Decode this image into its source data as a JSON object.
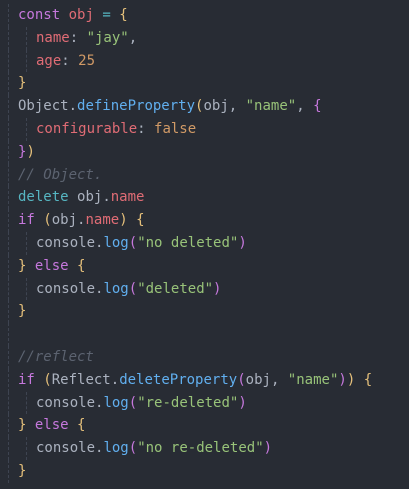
{
  "editor": {
    "lines": [
      [
        {
          "t": "const",
          "c": "k"
        },
        {
          "t": " ",
          "c": "pl"
        },
        {
          "t": "obj",
          "c": "v"
        },
        {
          "t": " = ",
          "c": "kb"
        },
        {
          "t": "{",
          "c": "br1"
        }
      ],
      [
        {
          "t": "name",
          "c": "prop"
        },
        {
          "t": ": ",
          "c": "pl"
        },
        {
          "t": "\"jay\"",
          "c": "str"
        },
        {
          "t": ",",
          "c": "pl"
        }
      ],
      [
        {
          "t": "age",
          "c": "prop"
        },
        {
          "t": ": ",
          "c": "pl"
        },
        {
          "t": "25",
          "c": "num"
        }
      ],
      [
        {
          "t": "}",
          "c": "br1"
        }
      ],
      [
        {
          "t": "Object",
          "c": "pl"
        },
        {
          "t": ".",
          "c": "pl"
        },
        {
          "t": "defineProperty",
          "c": "fn"
        },
        {
          "t": "(",
          "c": "br1"
        },
        {
          "t": "obj",
          "c": "pl"
        },
        {
          "t": ", ",
          "c": "pl"
        },
        {
          "t": "\"name\"",
          "c": "str"
        },
        {
          "t": ", ",
          "c": "pl"
        },
        {
          "t": "{",
          "c": "br2"
        }
      ],
      [
        {
          "t": "configurable",
          "c": "prop"
        },
        {
          "t": ": ",
          "c": "pl"
        },
        {
          "t": "false",
          "c": "bool"
        }
      ],
      [
        {
          "t": "}",
          "c": "br2"
        },
        {
          "t": ")",
          "c": "br1"
        }
      ],
      [
        {
          "t": "// Object.",
          "c": "cm"
        }
      ],
      [
        {
          "t": "delete",
          "c": "kb"
        },
        {
          "t": " ",
          "c": "pl"
        },
        {
          "t": "obj",
          "c": "pl"
        },
        {
          "t": ".",
          "c": "pl"
        },
        {
          "t": "name",
          "c": "prop"
        }
      ],
      [
        {
          "t": "if",
          "c": "k"
        },
        {
          "t": " ",
          "c": "pl"
        },
        {
          "t": "(",
          "c": "br1"
        },
        {
          "t": "obj",
          "c": "pl"
        },
        {
          "t": ".",
          "c": "pl"
        },
        {
          "t": "name",
          "c": "prop"
        },
        {
          "t": ")",
          "c": "br1"
        },
        {
          "t": " ",
          "c": "pl"
        },
        {
          "t": "{",
          "c": "br1"
        }
      ],
      [
        {
          "t": "console",
          "c": "pl"
        },
        {
          "t": ".",
          "c": "pl"
        },
        {
          "t": "log",
          "c": "fn"
        },
        {
          "t": "(",
          "c": "br2"
        },
        {
          "t": "\"no deleted\"",
          "c": "str"
        },
        {
          "t": ")",
          "c": "br2"
        }
      ],
      [
        {
          "t": "}",
          "c": "br1"
        },
        {
          "t": " ",
          "c": "pl"
        },
        {
          "t": "else",
          "c": "k"
        },
        {
          "t": " ",
          "c": "pl"
        },
        {
          "t": "{",
          "c": "br1"
        }
      ],
      [
        {
          "t": "console",
          "c": "pl"
        },
        {
          "t": ".",
          "c": "pl"
        },
        {
          "t": "log",
          "c": "fn"
        },
        {
          "t": "(",
          "c": "br2"
        },
        {
          "t": "\"deleted\"",
          "c": "str"
        },
        {
          "t": ")",
          "c": "br2"
        }
      ],
      [
        {
          "t": "}",
          "c": "br1"
        }
      ],
      [],
      [
        {
          "t": "//reflect",
          "c": "cm"
        }
      ],
      [
        {
          "t": "if",
          "c": "k"
        },
        {
          "t": " ",
          "c": "pl"
        },
        {
          "t": "(",
          "c": "br1"
        },
        {
          "t": "Reflect",
          "c": "pl"
        },
        {
          "t": ".",
          "c": "pl"
        },
        {
          "t": "deleteProperty",
          "c": "fn"
        },
        {
          "t": "(",
          "c": "br2"
        },
        {
          "t": "obj",
          "c": "pl"
        },
        {
          "t": ", ",
          "c": "pl"
        },
        {
          "t": "\"name\"",
          "c": "str"
        },
        {
          "t": ")",
          "c": "br2"
        },
        {
          "t": ")",
          "c": "br1"
        },
        {
          "t": " ",
          "c": "pl"
        },
        {
          "t": "{",
          "c": "br1"
        }
      ],
      [
        {
          "t": "console",
          "c": "pl"
        },
        {
          "t": ".",
          "c": "pl"
        },
        {
          "t": "log",
          "c": "fn"
        },
        {
          "t": "(",
          "c": "br2"
        },
        {
          "t": "\"re-deleted\"",
          "c": "str"
        },
        {
          "t": ")",
          "c": "br2"
        }
      ],
      [
        {
          "t": "}",
          "c": "br1"
        },
        {
          "t": " ",
          "c": "pl"
        },
        {
          "t": "else",
          "c": "k"
        },
        {
          "t": " ",
          "c": "pl"
        },
        {
          "t": "{",
          "c": "br1"
        }
      ],
      [
        {
          "t": "console",
          "c": "pl"
        },
        {
          "t": ".",
          "c": "pl"
        },
        {
          "t": "log",
          "c": "fn"
        },
        {
          "t": "(",
          "c": "br2"
        },
        {
          "t": "\"no re-deleted\"",
          "c": "str"
        },
        {
          "t": ")",
          "c": "br2"
        }
      ],
      [
        {
          "t": "}",
          "c": "br1"
        }
      ]
    ],
    "indent_levels": [
      0,
      1,
      1,
      0,
      0,
      1,
      0,
      0,
      0,
      0,
      1,
      0,
      1,
      0,
      0,
      0,
      0,
      1,
      0,
      1,
      0
    ]
  }
}
